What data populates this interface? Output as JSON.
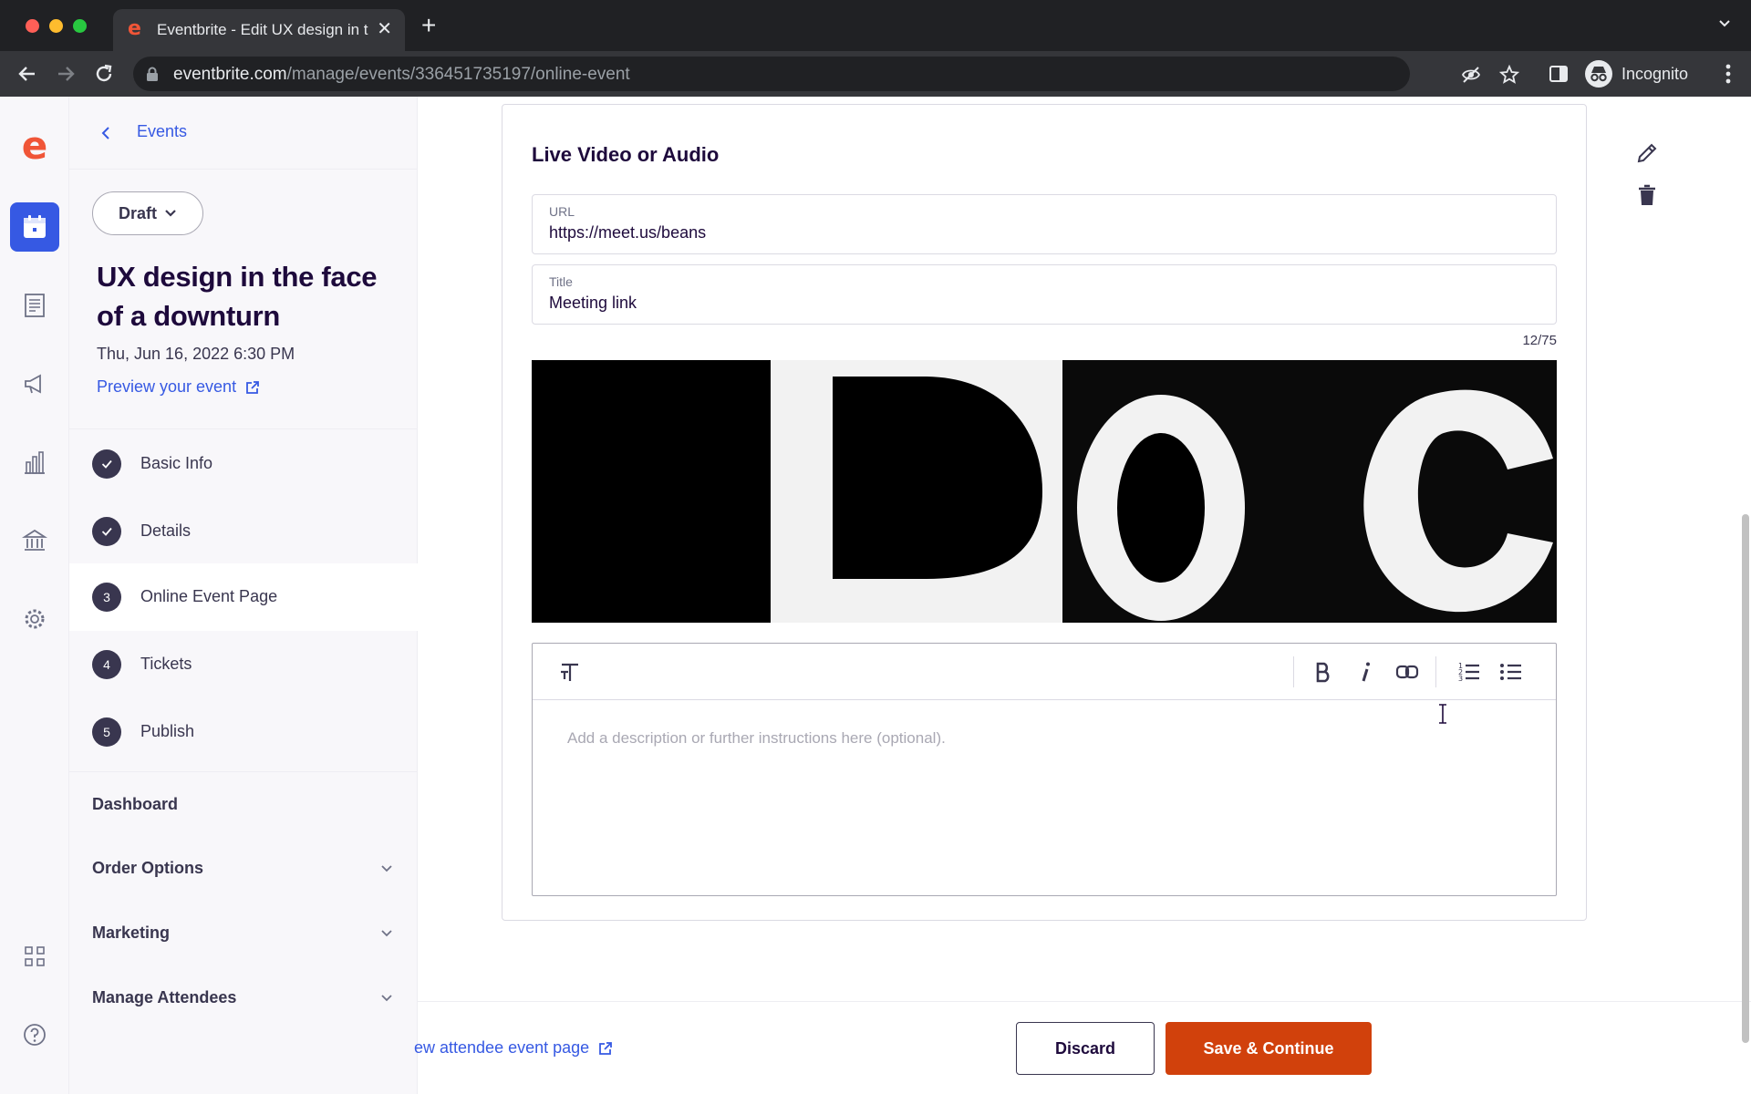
{
  "browser": {
    "tab_title": "Eventbrite - Edit UX design in t",
    "url_host": "eventbrite.com",
    "url_path": "/manage/events/336451735197/online-event",
    "profile_label": "Incognito"
  },
  "sidebar": {
    "back_label": "Events",
    "status_label": "Draft",
    "event_title": "UX design in the face of a downturn",
    "event_date": "Thu, Jun 16, 2022 6:30 PM",
    "preview_label": "Preview your event",
    "steps": [
      {
        "badge": "",
        "label": "Basic Info",
        "done": true
      },
      {
        "badge": "",
        "label": "Details",
        "done": true
      },
      {
        "badge": "3",
        "label": "Online Event Page",
        "current": true
      },
      {
        "badge": "4",
        "label": "Tickets"
      },
      {
        "badge": "5",
        "label": "Publish"
      }
    ],
    "links": [
      {
        "label": "Dashboard",
        "expandable": false
      },
      {
        "label": "Order Options",
        "expandable": true
      },
      {
        "label": "Marketing",
        "expandable": true
      },
      {
        "label": "Manage Attendees",
        "expandable": true
      }
    ]
  },
  "rail_icons": [
    "eventbrite-logo-icon",
    "calendar-icon",
    "orders-icon",
    "megaphone-icon",
    "bar-chart-icon",
    "bank-icon",
    "gear-icon",
    "apps-grid-icon",
    "help-icon"
  ],
  "card": {
    "title": "Live Video or Audio",
    "url_label": "URL",
    "url_value": "https://meet.us/beans",
    "title_label": "Title",
    "title_value": "Meeting link",
    "char_count": "12/75",
    "description_placeholder": "Add a description or further instructions here (optional)."
  },
  "footer": {
    "attendee_link": "ew attendee event page",
    "discard_label": "Discard",
    "save_label": "Save & Continue"
  },
  "colors": {
    "brand": "#f05537",
    "accent": "#3659e3",
    "primary_button": "#d1410c"
  }
}
